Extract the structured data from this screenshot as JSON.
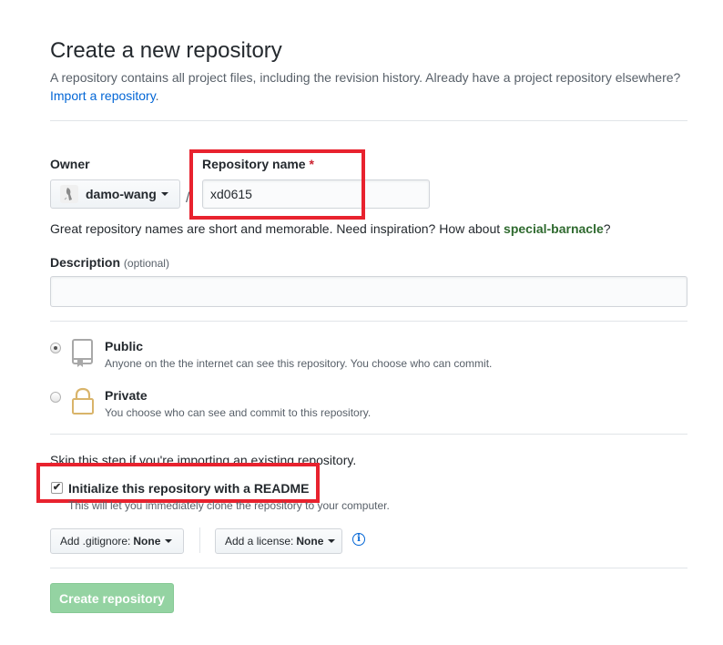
{
  "page": {
    "title": "Create a new repository",
    "subtitle": "A repository contains all project files, including the revision history. Already have a project repository elsewhere?",
    "import_link": "Import a repository",
    "import_period": "."
  },
  "owner": {
    "label": "Owner",
    "value": "damo-wang",
    "slash": "/"
  },
  "repo_name": {
    "label": "Repository name",
    "required_mark": "*",
    "value": "xd0615"
  },
  "hint": {
    "prefix": "Great repository names are short and memorable. Need inspiration? How about ",
    "suggestion": "special-barnacle",
    "suffix": "?"
  },
  "description": {
    "label": "Description",
    "optional": "(optional)",
    "value": ""
  },
  "visibility": {
    "selected": "public",
    "public_title": "Public",
    "public_desc": "Anyone on the the internet can see this repository. You choose who can commit.",
    "private_title": "Private",
    "private_desc": "You choose who can see and commit to this repository."
  },
  "init": {
    "skip_note": "Skip this step if you're importing an existing repository.",
    "readme_label": "Initialize this repository with a README",
    "readme_checked": true,
    "readme_desc": "This will let you immediately clone the repository to your computer."
  },
  "options": {
    "gitignore_label": "Add .gitignore:",
    "gitignore_value": "None",
    "license_label": "Add a license:",
    "license_value": "None",
    "info_glyph": "i"
  },
  "submit": {
    "label": "Create repository"
  },
  "colors": {
    "annotation_red": "#e8222e",
    "link_blue": "#0366d6",
    "suggestion_green": "#2f6a2f",
    "button_green_disabled": "#94d3a2"
  },
  "icons": {
    "repo": "repo-icon",
    "lock": "lock-icon",
    "info": "info-icon"
  }
}
